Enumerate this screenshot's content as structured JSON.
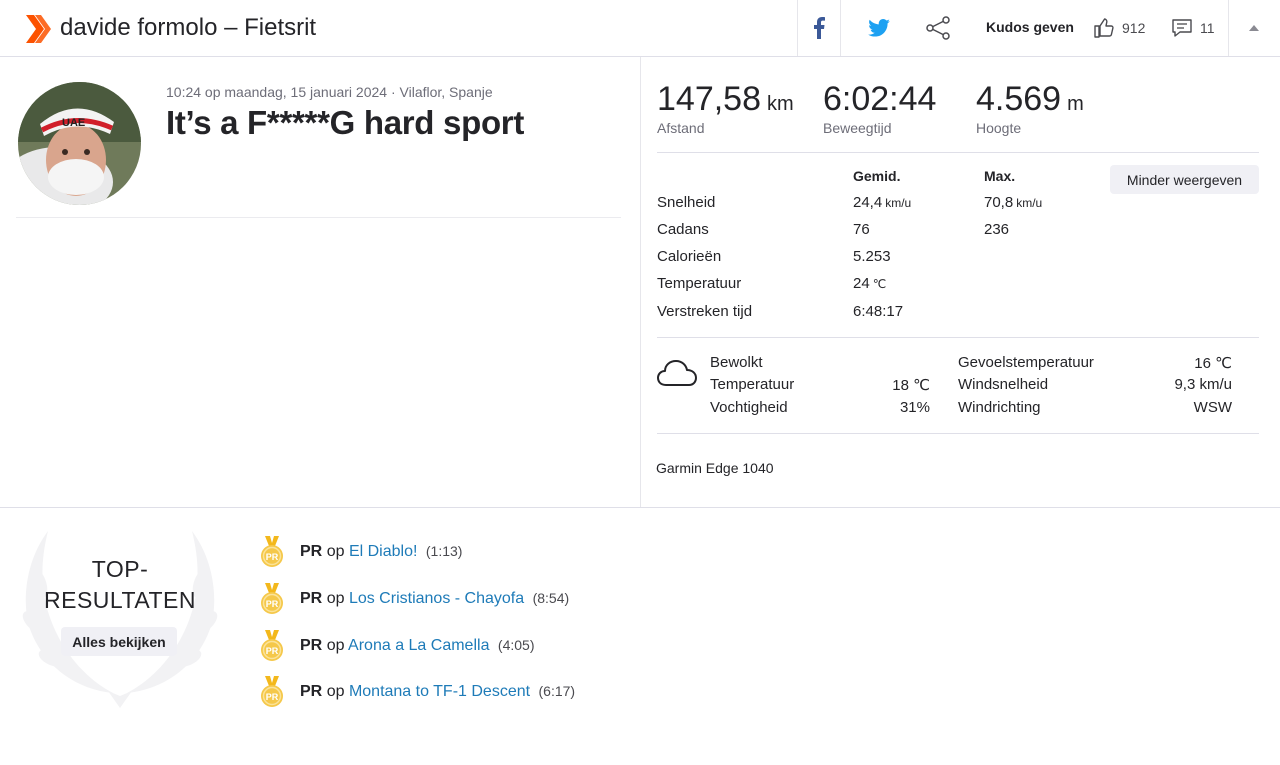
{
  "header": {
    "title": "davide formolo – Fietsrit",
    "kudos_label": "Kudos geven",
    "kudos_count": "912",
    "comments_count": "11",
    "icons": [
      "strava-logo-icon",
      "facebook-icon",
      "twitter-icon",
      "share-icon",
      "thumbs-up-icon",
      "comment-icon",
      "chevron-up-icon"
    ],
    "colors": {
      "brand": "#fc5200",
      "facebook": "#3b5998",
      "twitter": "#1da1f2"
    }
  },
  "activity": {
    "meta": "10:24 op maandag, 15 januari 2024 · Vilaflor, Spanje",
    "title": "It’s a F*****G hard sport"
  },
  "stats": {
    "distance": {
      "value": "147,58",
      "unit": "km",
      "label": "Afstand"
    },
    "moving_time": {
      "value": "6:02:44",
      "label": "Beweegtijd"
    },
    "elevation": {
      "value": "4.569",
      "unit": "m",
      "label": "Hoogte"
    }
  },
  "details": {
    "col_avg": "Gemid.",
    "col_max": "Max.",
    "less_button": "Minder weergeven",
    "rows": [
      {
        "label": "Snelheid",
        "avg": "24,4",
        "avg_unit": "km/u",
        "max": "70,8",
        "max_unit": "km/u"
      },
      {
        "label": "Cadans",
        "avg": "76",
        "avg_unit": "",
        "max": "236",
        "max_unit": ""
      },
      {
        "label": "Calorieën",
        "avg": "5.253",
        "avg_unit": "",
        "max": "",
        "max_unit": ""
      },
      {
        "label": "Temperatuur",
        "avg": "24",
        "avg_unit": "℃",
        "max": "",
        "max_unit": ""
      },
      {
        "label": "Verstreken tijd",
        "avg": "6:48:17",
        "avg_unit": "",
        "max": "",
        "max_unit": ""
      }
    ]
  },
  "weather": {
    "condition": "Bewolkt",
    "temp_label": "Temperatuur",
    "temp_value": "18 ℃",
    "humidity_label": "Vochtigheid",
    "humidity_value": "31%",
    "feels_label": "Gevoelstemperatuur",
    "feels_value": "16 ℃",
    "wind_speed_label": "Windsnelheid",
    "wind_speed_value": "9,3 km/u",
    "wind_dir_label": "Windrichting",
    "wind_dir_value": "WSW"
  },
  "device": "Garmin Edge 1040",
  "top_results": {
    "title_line1": "TOP-",
    "title_line2": "RESULTATEN",
    "see_all": "Alles bekijken",
    "medal_text": "PR",
    "items": [
      {
        "prefix": "PR",
        "op": "op",
        "segment": "El Diablo!",
        "time": "(1:13)"
      },
      {
        "prefix": "PR",
        "op": "op",
        "segment": "Los Cristianos - Chayofa",
        "time": "(8:54)"
      },
      {
        "prefix": "PR",
        "op": "op",
        "segment": "Arona a La Camella",
        "time": "(4:05)"
      },
      {
        "prefix": "PR",
        "op": "op",
        "segment": "Montana to TF-1 Descent",
        "time": "(6:17)"
      }
    ]
  }
}
